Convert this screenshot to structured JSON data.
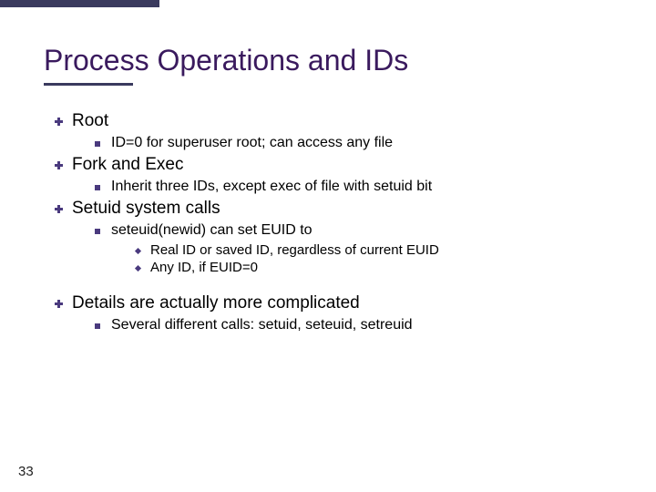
{
  "slide": {
    "title": "Process Operations and IDs",
    "page_number": "33",
    "items": {
      "root": {
        "label": "Root",
        "sub1": "ID=0 for superuser root; can access any file"
      },
      "fork": {
        "label": "Fork and Exec",
        "sub1": "Inherit three IDs, except exec of file with setuid bit"
      },
      "setuid": {
        "label": "Setuid system calls",
        "sub1": "seteuid(newid) can set EUID to",
        "sub1a": "Real ID or saved ID, regardless of current EUID",
        "sub1b": "Any ID, if EUID=0"
      },
      "details": {
        "label": "Details are actually more complicated",
        "sub1": "Several different calls: setuid, seteuid, setreuid"
      }
    }
  }
}
